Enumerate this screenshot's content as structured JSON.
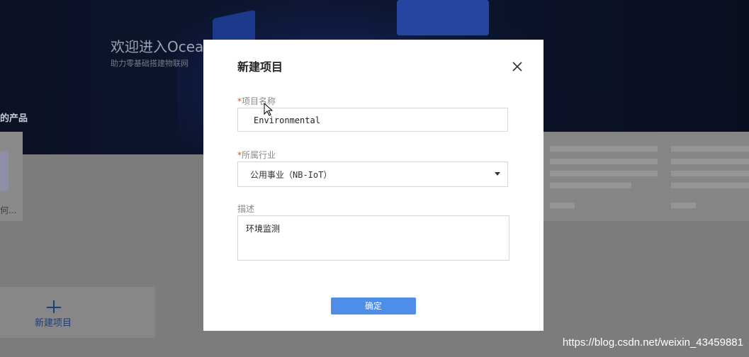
{
  "background": {
    "banner_title": "欢迎进入Ocea",
    "banner_subtitle": "助力零基础搭建物联网",
    "section_title": "的产品",
    "product_caption": "何...",
    "new_project_label": "新建项目",
    "watermark": "https://blog.csdn.net/weixin_43459881"
  },
  "modal": {
    "title": "新建项目",
    "close_icon": "close-icon",
    "fields": {
      "name": {
        "required_mark": "*",
        "label": "项目名称",
        "value": "Environmental"
      },
      "industry": {
        "required_mark": "*",
        "label": "所属行业",
        "value": "公用事业（NB-IoT）"
      },
      "description": {
        "label": "描述",
        "value": "环境监测"
      }
    },
    "confirm_label": "确定"
  },
  "colors": {
    "accent": "#4e8ee8",
    "required": "#e0502f",
    "overlay": "#7c7c7c"
  }
}
